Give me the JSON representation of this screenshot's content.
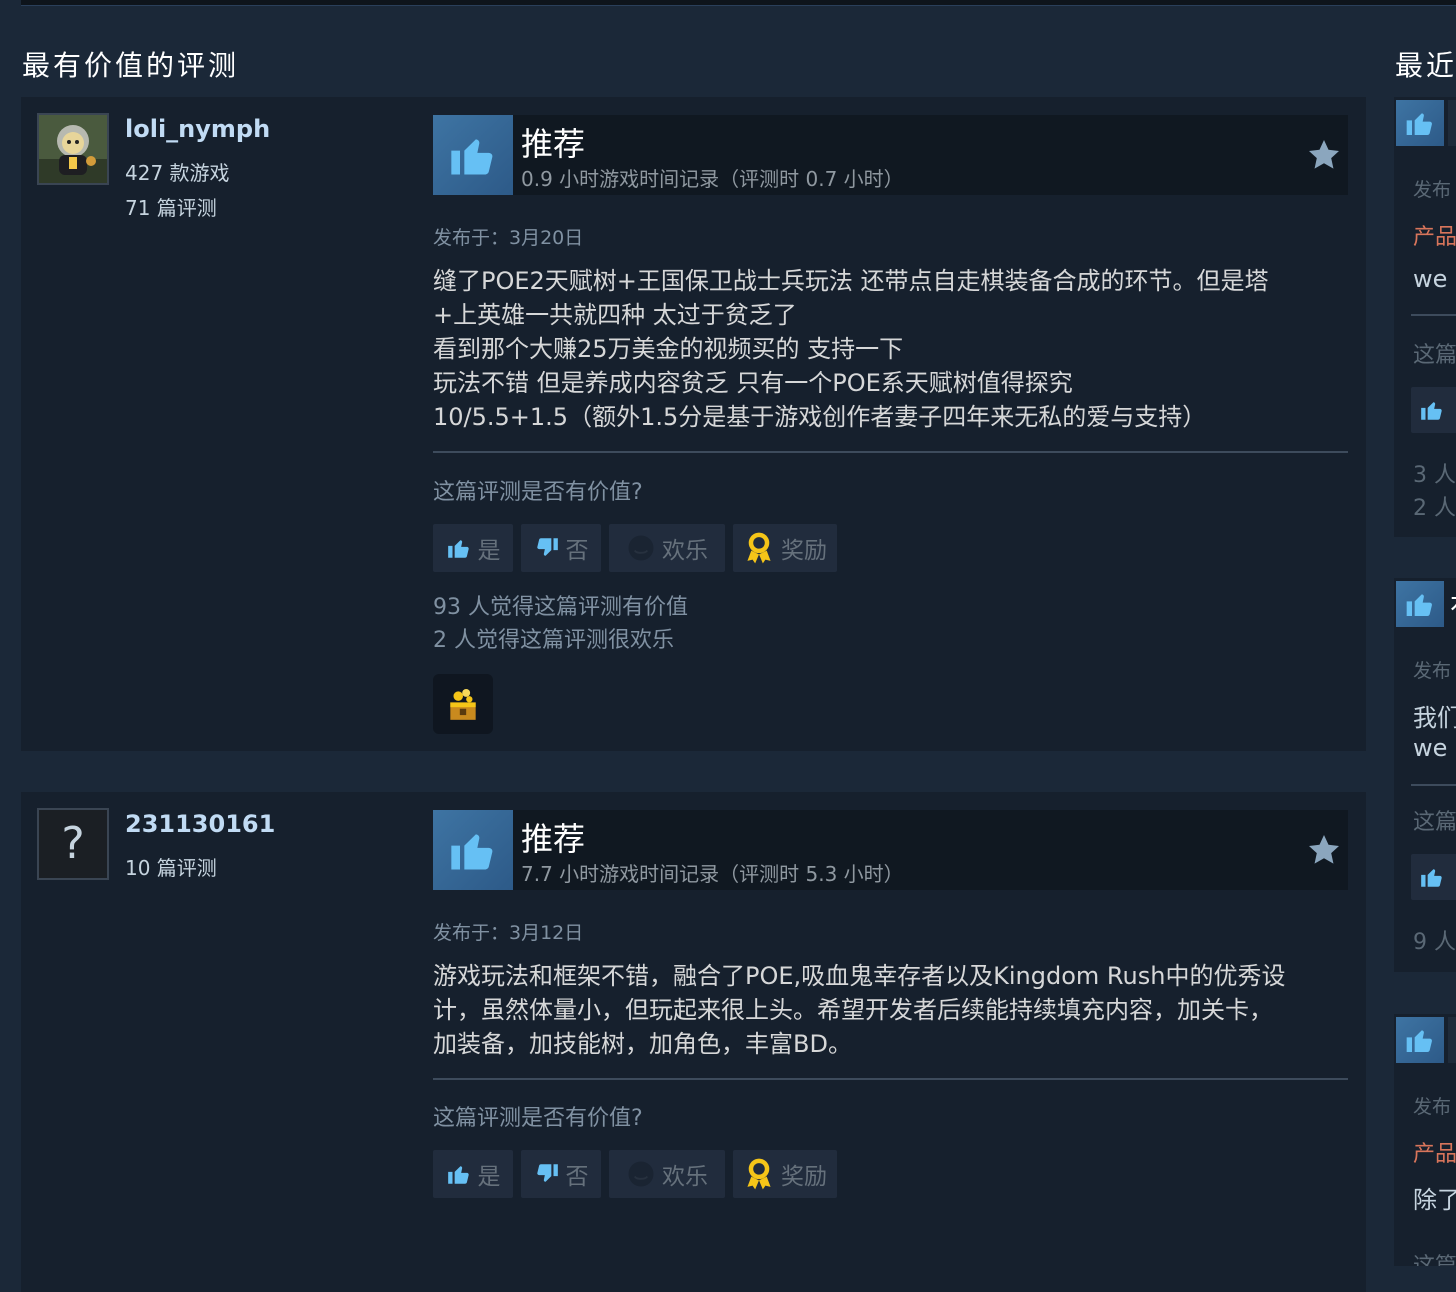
{
  "sections": {
    "left_title": "最有价值的评测",
    "right_title": "最近"
  },
  "reviews": [
    {
      "author": "loli_nymph",
      "games": "427 款游戏",
      "review_count": "71 篇评测",
      "vote": "推荐",
      "hours": "0.9 小时游戏时间记录（评测时 0.7 小时）",
      "posted": "发布于：3月20日",
      "content": [
        "缝了POE2天赋树+王国保卫战士兵玩法 还带点自走棋装备合成的环节。但是塔",
        "+上英雄一共就四种 太过于贫乏了",
        "看到那个大赚25万美金的视频买的 支持一下",
        "玩法不错 但是养成内容贫乏 只有一个POE系天赋树值得探究",
        "10/5.5+1.5（额外1.5分是基于游戏创作者妻子四年来无私的爱与支持）"
      ],
      "helpful_question": "这篇评测是否有价值?",
      "buttons": {
        "yes": "是",
        "no": "否",
        "funny": "欢乐",
        "award": "奖励"
      },
      "helpful_count": "93 人觉得这篇评测有价值",
      "funny_count": "2 人觉得这篇评测很欢乐"
    },
    {
      "author": "231130161",
      "avatar_placeholder": "?",
      "review_count": "10 篇评测",
      "vote": "推荐",
      "hours": "7.7 小时游戏时间记录（评测时 5.3 小时）",
      "posted": "发布于：3月12日",
      "content": [
        "游戏玩法和框架不错，融合了POE,吸血鬼幸存者以及Kingdom Rush中的优秀设",
        "计，虽然体量小，但玩起来很上头。希望开发者后续能持续填充内容，加关卡，",
        "加装备，加技能树，加角色，丰富BD。"
      ],
      "helpful_question": "这篇评测是否有价值?",
      "buttons": {
        "yes": "是",
        "no": "否",
        "funny": "欢乐",
        "award": "奖励"
      }
    }
  ],
  "recent": [
    {
      "posted": "发布",
      "tag": "产品",
      "body": "we",
      "question": "这篇",
      "count1": "3 人",
      "count2": "2 人"
    },
    {
      "header_char": "有",
      "posted": "发布",
      "body1": "我们",
      "body2": "we",
      "question": "这篇",
      "count1": "9 人"
    },
    {
      "posted": "发布",
      "tag": "产品",
      "body": "除了",
      "question": "这篇"
    }
  ],
  "colors": {
    "background": "#1b2838",
    "card": "#16202d",
    "thumb_blue": "#3e74a3",
    "author_blue": "#c1dbf4",
    "award_gold": "#f5c518",
    "orange": "#d8755b"
  },
  "icons": [
    "thumbs-up-icon",
    "thumbs-down-icon",
    "star-icon",
    "laugh-icon",
    "award-icon",
    "treasure-award-icon"
  ]
}
